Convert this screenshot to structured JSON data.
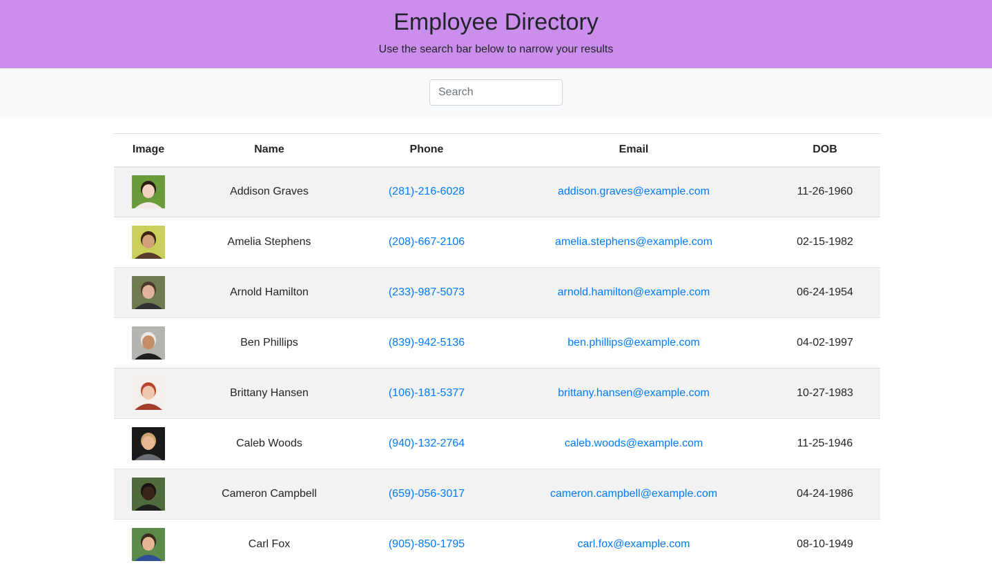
{
  "header": {
    "title": "Employee Directory",
    "subtitle": "Use the search bar below to narrow your results"
  },
  "search": {
    "placeholder": "Search",
    "value": ""
  },
  "table": {
    "columns": [
      "Image",
      "Name",
      "Phone",
      "Email",
      "DOB"
    ],
    "rows": [
      {
        "name": "Addison Graves",
        "phone": "(281)-216-6028",
        "email": "addison.graves@example.com",
        "dob": "11-26-1960",
        "bg": "#6b9a3a",
        "skin": "#f1d3c0",
        "hair": "#2b1c14",
        "shirt": "#f2e8e6"
      },
      {
        "name": "Amelia Stephens",
        "phone": "(208)-667-2106",
        "email": "amelia.stephens@example.com",
        "dob": "02-15-1982",
        "bg": "#c9cf58",
        "skin": "#d2a07a",
        "hair": "#3b2414",
        "shirt": "#5a3b2a"
      },
      {
        "name": "Arnold Hamilton",
        "phone": "(233)-987-5073",
        "email": "arnold.hamilton@example.com",
        "dob": "06-24-1954",
        "bg": "#6f7a4e",
        "skin": "#e0b49a",
        "hair": "#4b3a2a",
        "shirt": "#2f3133"
      },
      {
        "name": "Ben Phillips",
        "phone": "(839)-942-5136",
        "email": "ben.phillips@example.com",
        "dob": "04-02-1997",
        "bg": "#b5b4ae",
        "skin": "#c58d63",
        "hair": "#e9e9e9",
        "shirt": "#1e1e1e"
      },
      {
        "name": "Brittany Hansen",
        "phone": "(106)-181-5377",
        "email": "brittany.hansen@example.com",
        "dob": "10-27-1983",
        "bg": "#f3efea",
        "skin": "#f0c8b0",
        "hair": "#b8432a",
        "shirt": "#a53d2b"
      },
      {
        "name": "Caleb Woods",
        "phone": "(940)-132-2764",
        "email": "caleb.woods@example.com",
        "dob": "11-25-1946",
        "bg": "#1a1a1a",
        "skin": "#e8b894",
        "hair": "#c8a56a",
        "shirt": "#6a6f76"
      },
      {
        "name": "Cameron Campbell",
        "phone": "(659)-056-3017",
        "email": "cameron.campbell@example.com",
        "dob": "04-24-1986",
        "bg": "#4f6a3c",
        "skin": "#3a2418",
        "hair": "#1a1210",
        "shirt": "#1f1f1f"
      },
      {
        "name": "Carl Fox",
        "phone": "(905)-850-1795",
        "email": "carl.fox@example.com",
        "dob": "08-10-1949",
        "bg": "#5b8a4a",
        "skin": "#e3b594",
        "hair": "#3a2a1c",
        "shirt": "#2f4e9a"
      }
    ]
  }
}
